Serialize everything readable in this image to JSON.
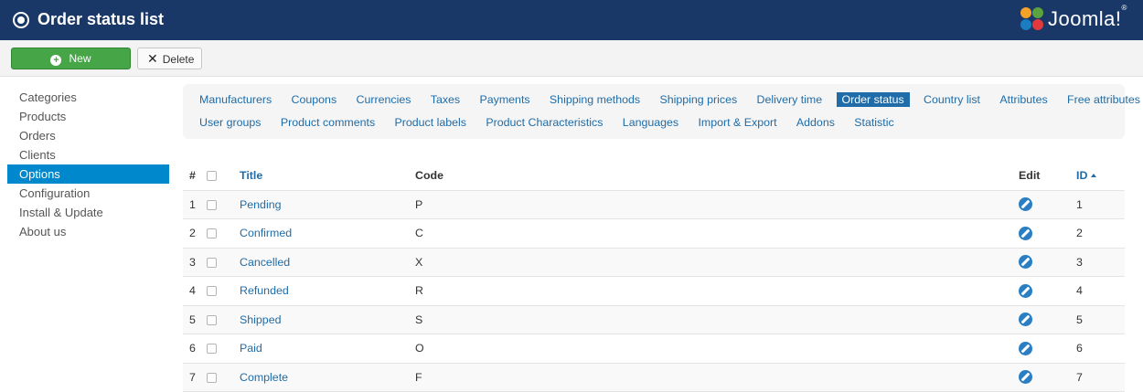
{
  "header": {
    "title": "Order status list",
    "logo_text": "Joomla!",
    "logo_reg": "®"
  },
  "toolbar": {
    "new_label": "New",
    "delete_label": "Delete"
  },
  "sidebar": {
    "items": [
      {
        "label": "Categories"
      },
      {
        "label": "Products"
      },
      {
        "label": "Orders"
      },
      {
        "label": "Clients"
      },
      {
        "label": "Options",
        "active": true
      },
      {
        "label": "Configuration"
      },
      {
        "label": "Install & Update"
      },
      {
        "label": "About us"
      }
    ]
  },
  "submenu": {
    "row1": [
      {
        "label": "Manufacturers"
      },
      {
        "label": "Coupons"
      },
      {
        "label": "Currencies"
      },
      {
        "label": "Taxes"
      },
      {
        "label": "Payments"
      },
      {
        "label": "Shipping methods"
      },
      {
        "label": "Shipping prices"
      },
      {
        "label": "Delivery time"
      },
      {
        "label": "Order status",
        "active": true
      },
      {
        "label": "Country list"
      },
      {
        "label": "Attributes"
      },
      {
        "label": "Free attributes"
      }
    ],
    "row2": [
      {
        "label": "User groups"
      },
      {
        "label": "Product comments"
      },
      {
        "label": "Product labels"
      },
      {
        "label": "Product Characteristics"
      },
      {
        "label": "Languages"
      },
      {
        "label": "Import & Export"
      },
      {
        "label": "Addons"
      },
      {
        "label": "Statistic"
      }
    ]
  },
  "table": {
    "headers": {
      "num": "#",
      "title": "Title",
      "code": "Code",
      "edit": "Edit",
      "id": "ID"
    },
    "rows": [
      {
        "num": "1",
        "title": "Pending",
        "code": "P",
        "id": "1"
      },
      {
        "num": "2",
        "title": "Confirmed",
        "code": "C",
        "id": "2"
      },
      {
        "num": "3",
        "title": "Cancelled",
        "code": "X",
        "id": "3"
      },
      {
        "num": "4",
        "title": "Refunded",
        "code": "R",
        "id": "4"
      },
      {
        "num": "5",
        "title": "Shipped",
        "code": "S",
        "id": "5"
      },
      {
        "num": "6",
        "title": "Paid",
        "code": "O",
        "id": "6"
      },
      {
        "num": "7",
        "title": "Complete",
        "code": "F",
        "id": "7"
      }
    ]
  },
  "colors": {
    "header_bg": "#1a3867",
    "accent": "#0088cc",
    "link": "#1f6ca8",
    "new_button": "#46a546"
  }
}
